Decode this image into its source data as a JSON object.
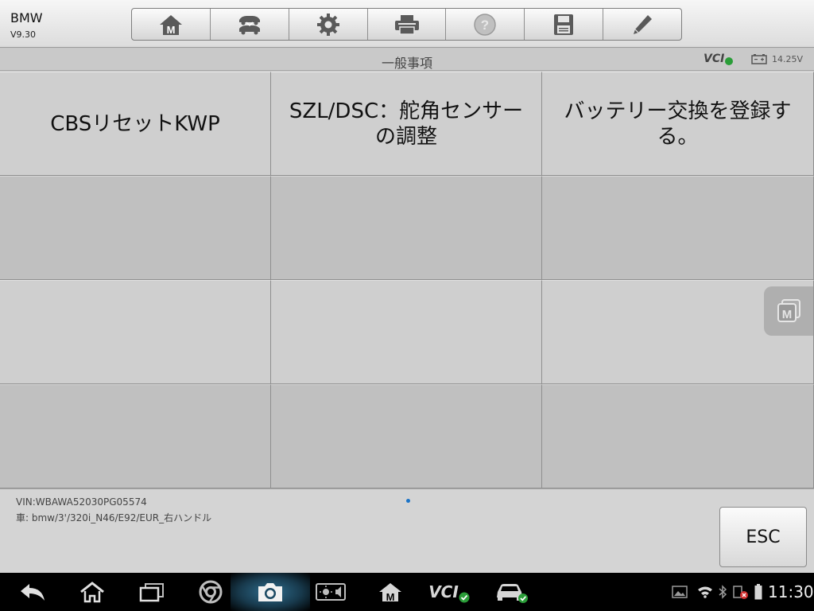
{
  "app": {
    "title": "BMW",
    "version": "V9.30"
  },
  "toolbar": {
    "buttons": [
      "home-icon",
      "vehicle-swap-icon",
      "settings-gear-icon",
      "printer-icon",
      "help-icon",
      "save-icon",
      "pen-icon"
    ]
  },
  "header": {
    "title": "一般事項",
    "vci_label": "VCI",
    "battery_voltage": "14.25V"
  },
  "grid": {
    "items": [
      "CBSリセットKWP",
      "SZL/DSC：舵角センサーの調整",
      "バッテリー交換を登録する。",
      "",
      "",
      "",
      "",
      "",
      "",
      "",
      "",
      ""
    ]
  },
  "footer": {
    "vin": "VIN:WBAWA52030PG05574",
    "vehicle": "車: bmw/3'/320i_N46/E92/EUR_右ハンドル",
    "esc_label": "ESC"
  },
  "navbar": {
    "items": [
      "back-icon",
      "home-icon",
      "recent-apps-icon",
      "chrome-icon",
      "camera-icon",
      "screen-settings-icon",
      "maxisys-icon",
      "vci-icon",
      "vehicle-icon"
    ],
    "vci_label": "VCI",
    "clock": "11:30"
  },
  "colors": {
    "accent_green": "#2a9d38",
    "page_dot": "#1a73c7"
  }
}
